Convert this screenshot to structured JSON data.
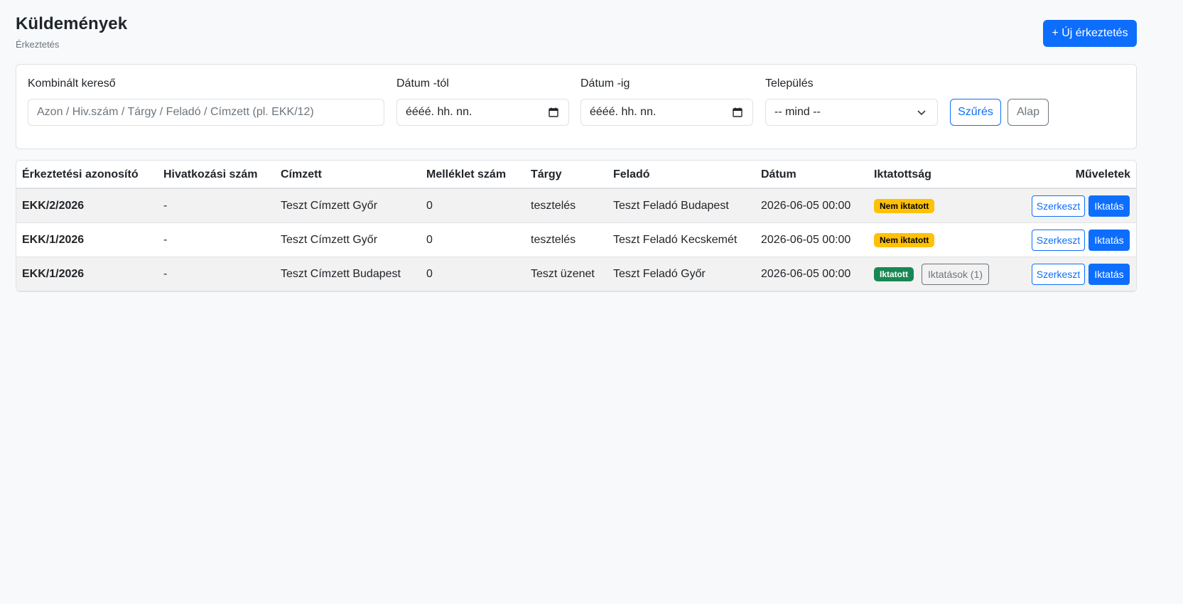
{
  "header": {
    "title": "Küldemények",
    "subtitle": "Érkeztetés",
    "new_button": "+ Új érkeztetés"
  },
  "filters": {
    "search": {
      "label": "Kombinált kereső",
      "placeholder": "Azon / Hiv.szám / Tárgy / Feladó / Címzett (pl. EKK/12)"
    },
    "date_from": {
      "label": "Dátum -tól",
      "value": "éééé. hh. nn.",
      "icon": "calendar-icon"
    },
    "date_to": {
      "label": "Dátum -ig",
      "value": "éééé. hh. nn.",
      "icon": "calendar-icon"
    },
    "settlement": {
      "label": "Település",
      "value": "-- mind --",
      "icon": "chevron-down-icon"
    },
    "filter_button": "Szűrés",
    "reset_button": "Alap"
  },
  "table": {
    "columns": [
      "Érkeztetési azonosító",
      "Hivatkozási szám",
      "Címzett",
      "Melléklet szám",
      "Tárgy",
      "Feladó",
      "Dátum",
      "Iktatottság",
      "Műveletek"
    ],
    "rows": [
      {
        "id": "EKK/2/2026",
        "ref": "-",
        "recipient": "Teszt Címzett Győr",
        "attachments": "0",
        "subject": "tesztelés",
        "sender": "Teszt Feladó Budapest",
        "date": "2026-06-05 00:00",
        "status": "Nem iktatott",
        "status_type": "warning",
        "extra": "",
        "edit": "Szerkeszt",
        "file": "Iktatás"
      },
      {
        "id": "EKK/1/2026",
        "ref": "-",
        "recipient": "Teszt Címzett Győr",
        "attachments": "0",
        "subject": "tesztelés",
        "sender": "Teszt Feladó Kecskemét",
        "date": "2026-06-05 00:00",
        "status": "Nem iktatott",
        "status_type": "warning",
        "extra": "",
        "edit": "Szerkeszt",
        "file": "Iktatás"
      },
      {
        "id": "EKK/1/2026",
        "ref": "-",
        "recipient": "Teszt Címzett Budapest",
        "attachments": "0",
        "subject": "Teszt üzenet",
        "sender": "Teszt Feladó Győr",
        "date": "2026-06-05 00:00",
        "status": "Iktatott",
        "status_type": "success",
        "extra": "Iktatások (1)",
        "edit": "Szerkeszt",
        "file": "Iktatás"
      }
    ]
  },
  "colors": {
    "primary": "#0d6efd",
    "warning": "#ffc107",
    "success": "#198754",
    "secondary": "#6c757d",
    "background": "#f8f9fa"
  }
}
